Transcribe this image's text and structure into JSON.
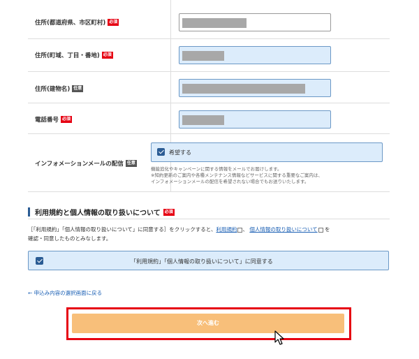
{
  "form": {
    "rows": [
      {
        "label": "住所(都道府県、市区町村)",
        "badge": "必須"
      },
      {
        "label": "住所(町域、丁目・番地)",
        "badge": "必須"
      },
      {
        "label": "住所(建物名)",
        "badge": "任意"
      },
      {
        "label": "電話番号",
        "badge": "必須"
      },
      {
        "label": "インフォメーションメールの配信",
        "badge": "任意"
      }
    ],
    "info_mail": {
      "checkbox_label": "希望する",
      "note_lines": [
        "機能追化やキャンペーンに関する情報をメールでお届けします。",
        "※知約更新のご案内や各種メンテナンス情報などサービスに関する重要なご案内は、",
        "インフォメーションメールの配信を希望されない場合でもお送りいたします。"
      ]
    }
  },
  "terms": {
    "title": "利用規約と個人情報の取り扱いについて",
    "badge": "必須",
    "text_before": "［「利用規約」「個人情報の取り扱いについて」に同意する］をクリックすると、",
    "link1": "利用規約",
    "sep": "、",
    "link2": "個人情報の取り扱いについて",
    "text_after_1": "を",
    "text_line2": "確認・同意したものとみなします。",
    "agree_label": "「利用規約」「個人情報の取り扱いについて」に同意する"
  },
  "nav": {
    "back_link": "← 申込み内容の選択画面に戻る",
    "next_button": "次へ進む"
  },
  "colors": {
    "required_badge": "#e60012",
    "optional_badge": "#555555",
    "input_bg": "#dcecfb",
    "next_button_bg": "#f8bf7a",
    "highlight_frame": "#e60012"
  }
}
